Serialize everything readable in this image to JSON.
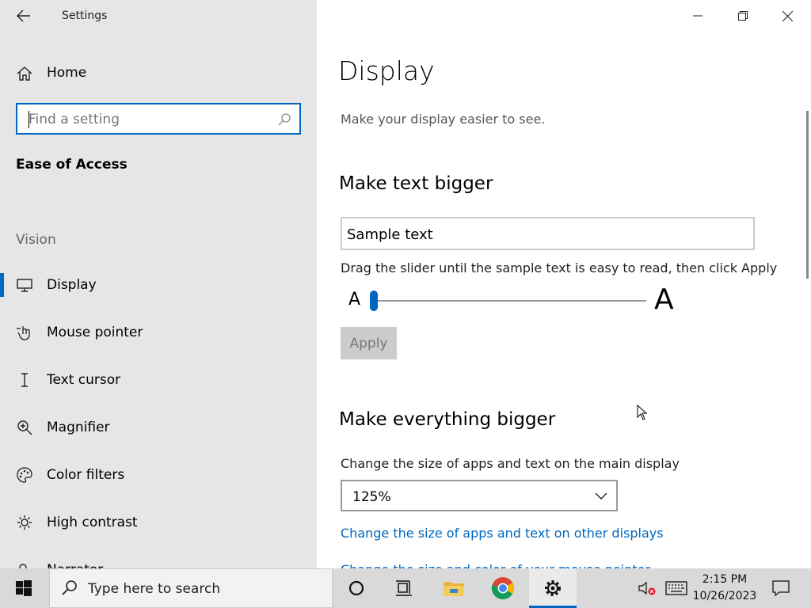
{
  "window": {
    "title": "Settings"
  },
  "sidebar": {
    "home_label": "Home",
    "search_placeholder": "Find a setting",
    "section_title": "Ease of Access",
    "group_label": "Vision",
    "items": [
      {
        "label": "Display",
        "icon": "monitor-icon",
        "active": true
      },
      {
        "label": "Mouse pointer",
        "icon": "mouse-pointer-icon"
      },
      {
        "label": "Text cursor",
        "icon": "text-cursor-icon"
      },
      {
        "label": "Magnifier",
        "icon": "magnifier-icon"
      },
      {
        "label": "Color filters",
        "icon": "color-filters-icon"
      },
      {
        "label": "High contrast",
        "icon": "high-contrast-icon"
      },
      {
        "label": "Narrator",
        "icon": "narrator-icon"
      }
    ]
  },
  "main": {
    "title": "Display",
    "subtitle": "Make your display easier to see.",
    "text_bigger": {
      "heading": "Make text bigger",
      "sample_text": "Sample text",
      "instruction": "Drag the slider until the sample text is easy to read, then click Apply",
      "small_a": "A",
      "big_a": "A",
      "slider_value": 0,
      "apply_label": "Apply"
    },
    "everything_bigger": {
      "heading": "Make everything bigger",
      "change_label": "Change the size of apps and text on the main display",
      "scale_value": "125%",
      "link_other_displays": "Change the size of apps and text on other displays",
      "link_partial": "Change the size and color of your mouse pointer"
    }
  },
  "taskbar": {
    "search_placeholder": "Type here to search",
    "time": "2:15 PM",
    "date": "10/26/2023"
  },
  "colors": {
    "accent": "#0067c0",
    "sidebar_bg": "#e6e6e6",
    "taskbar_bg": "#d9d9d9"
  }
}
